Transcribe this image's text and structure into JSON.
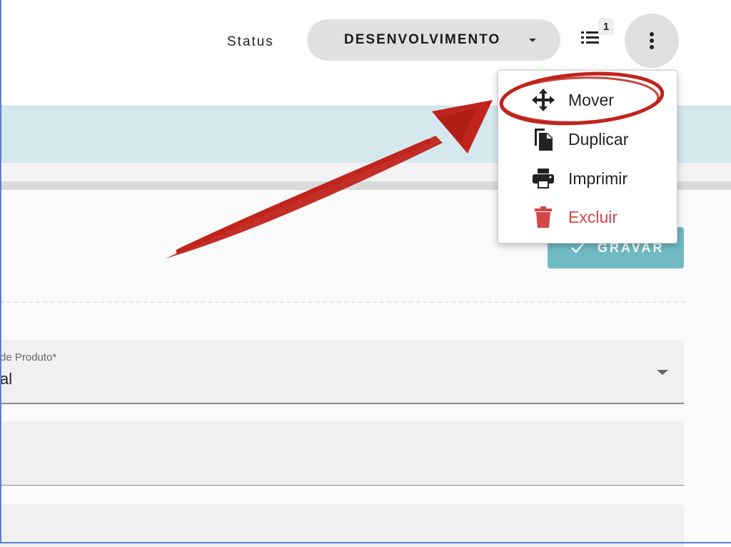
{
  "header": {
    "status_label": "Status",
    "status_value": "DESENVOLVIMENTO",
    "notification_count": "1"
  },
  "menu": {
    "items": [
      {
        "label": "Mover",
        "icon": "move-icon"
      },
      {
        "label": "Duplicar",
        "icon": "duplicate-icon"
      },
      {
        "label": "Imprimir",
        "icon": "print-icon"
      },
      {
        "label": "Excluir",
        "icon": "trash-icon"
      }
    ]
  },
  "actions": {
    "save_label": "GRAVAR"
  },
  "form": {
    "product_type_label": "de Produto*",
    "product_type_value": "al"
  },
  "colors": {
    "band": "#d5e8ee",
    "save_button": "#6fbac3",
    "danger": "#d64549",
    "annotation": "#c0241c"
  }
}
